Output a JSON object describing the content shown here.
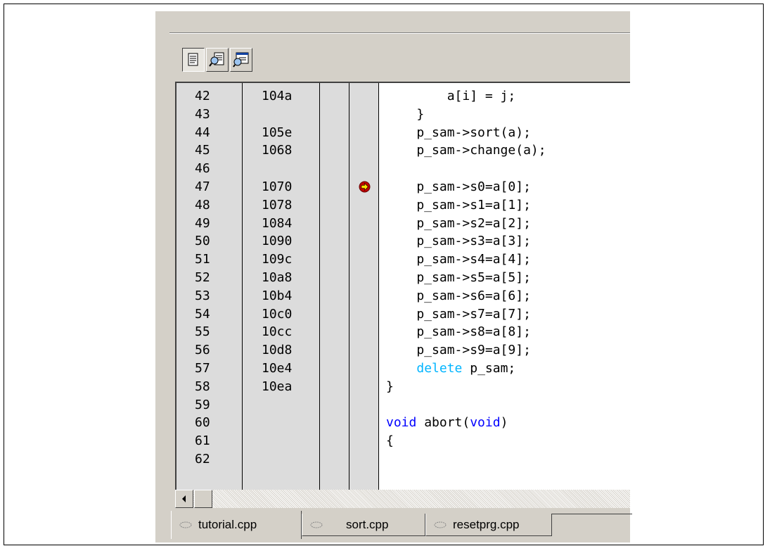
{
  "toolbar": {
    "buttons": [
      {
        "icon": "source-view-icon",
        "pressed": true
      },
      {
        "icon": "mixed-view-icon",
        "pressed": false
      },
      {
        "icon": "disassembly-view-icon",
        "pressed": false
      }
    ]
  },
  "editor": {
    "current_line": "47",
    "rows": [
      {
        "line": "42",
        "address": "104a",
        "code": "        a[i] = j;"
      },
      {
        "line": "43",
        "address": "",
        "code": "    }"
      },
      {
        "line": "44",
        "address": "105e",
        "code": "    p_sam->sort(a);"
      },
      {
        "line": "45",
        "address": "1068",
        "code": "    p_sam->change(a);"
      },
      {
        "line": "46",
        "address": "",
        "code": ""
      },
      {
        "line": "47",
        "address": "1070",
        "code": "    p_sam->s0=a[0];"
      },
      {
        "line": "48",
        "address": "1078",
        "code": "    p_sam->s1=a[1];"
      },
      {
        "line": "49",
        "address": "1084",
        "code": "    p_sam->s2=a[2];"
      },
      {
        "line": "50",
        "address": "1090",
        "code": "    p_sam->s3=a[3];"
      },
      {
        "line": "51",
        "address": "109c",
        "code": "    p_sam->s4=a[4];"
      },
      {
        "line": "52",
        "address": "10a8",
        "code": "    p_sam->s5=a[5];"
      },
      {
        "line": "53",
        "address": "10b4",
        "code": "    p_sam->s6=a[6];"
      },
      {
        "line": "54",
        "address": "10c0",
        "code": "    p_sam->s7=a[7];"
      },
      {
        "line": "55",
        "address": "10cc",
        "code": "    p_sam->s8=a[8];"
      },
      {
        "line": "56",
        "address": "10d8",
        "code": "    p_sam->s9=a[9];"
      },
      {
        "line": "57",
        "address": "10e4",
        "code": "    delete p_sam;"
      },
      {
        "line": "58",
        "address": "10ea",
        "code": "}"
      },
      {
        "line": "59",
        "address": "",
        "code": ""
      },
      {
        "line": "60",
        "address": "",
        "code": "void abort(void)"
      },
      {
        "line": "61",
        "address": "",
        "code": "{"
      },
      {
        "line": "62",
        "address": "",
        "code": ""
      }
    ]
  },
  "tabs": [
    {
      "label": "tutorial.cpp",
      "active": true
    },
    {
      "label": "sort.cpp",
      "active": false
    },
    {
      "label": "resetprg.cpp",
      "active": false
    }
  ],
  "colors": {
    "keyword": "#0000ff",
    "keyword_light": "#00b4ff",
    "gutter": "#dcdcdc",
    "chrome": "#d4d0c8"
  }
}
